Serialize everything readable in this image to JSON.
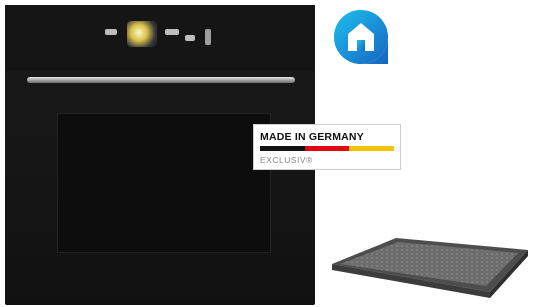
{
  "label": {
    "title": "MADE IN GERMANY",
    "subtitle": "EXCLUSIV®",
    "flag_colors": [
      "#111111",
      "#e30613",
      "#f5c400"
    ]
  },
  "colors": {
    "oven_body": "#141414",
    "app_badge_blue": "#1e88e5",
    "tray_grey": "#5a5a5a"
  },
  "icons": {
    "app_badge": "home-icon"
  }
}
